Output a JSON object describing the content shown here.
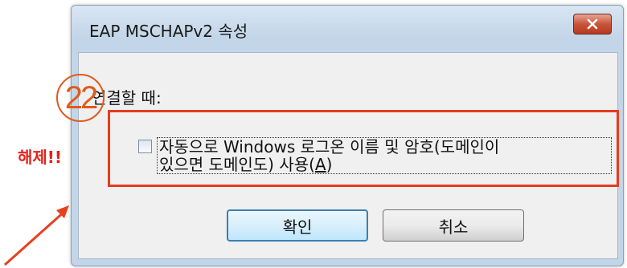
{
  "dialog": {
    "title": "EAP MSCHAPv2 속성",
    "close_icon": "close-icon"
  },
  "content": {
    "section_label": "연결할 때:",
    "checkbox": {
      "checked": false,
      "label_line1": "자동으로 Windows 로그온 이름 및 암호(도메인이",
      "label_line2_pre": "있으면 도메인도) 사용(",
      "label_line2_hotkey": "A",
      "label_line2_post": ")"
    }
  },
  "buttons": {
    "ok_label": "확인",
    "cancel_label": "취소"
  },
  "annotations": {
    "step_number": "22",
    "release_note": "해제!!",
    "highlight_color": "#e53b1f",
    "arrow_color": "#e8401f"
  }
}
